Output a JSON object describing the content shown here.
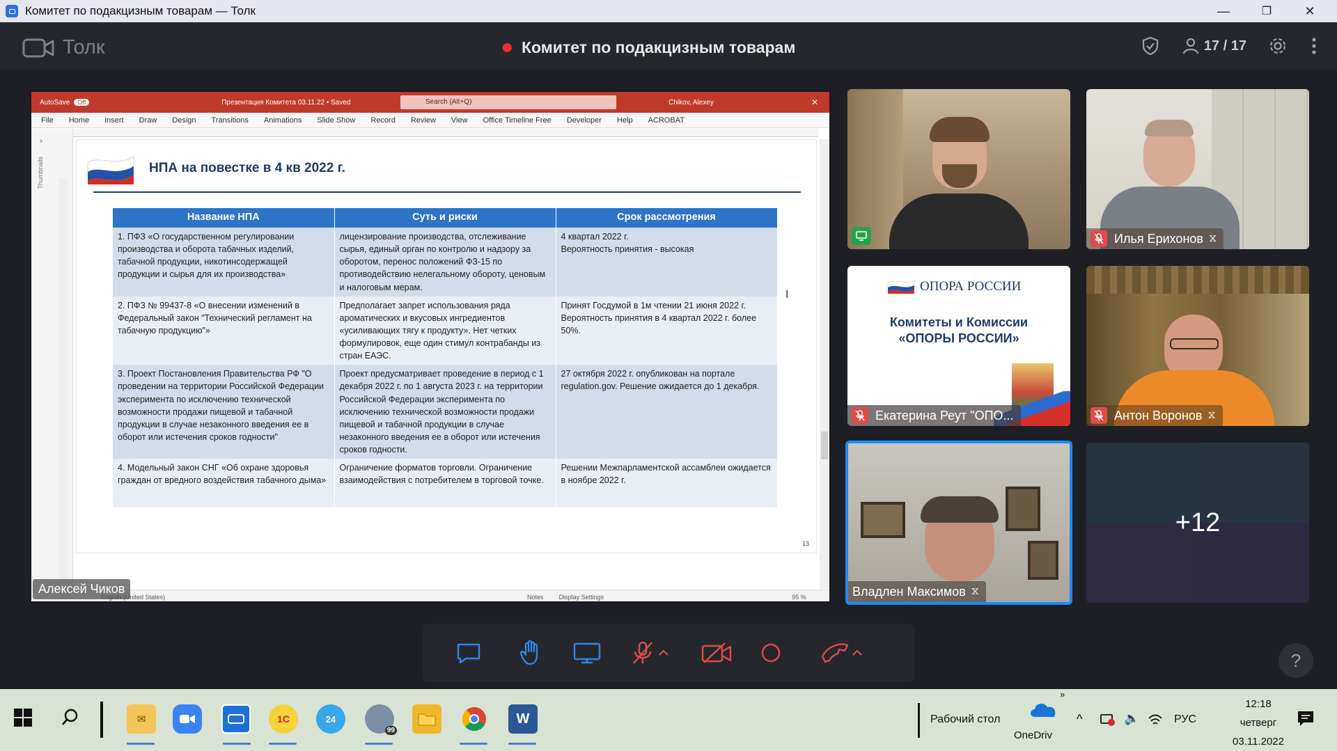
{
  "window": {
    "title": "Комитет по подакцизным товарам — Толк",
    "minimize": "—",
    "maximize": "❐",
    "close": "✕"
  },
  "header": {
    "brand": "Толк",
    "meeting_title": "Комитет по подакцизным товарам",
    "participants": "17 / 17"
  },
  "ppt": {
    "autosave": "AutoSave",
    "autosave_state": "Off",
    "doc_title": "Презентация Комитета 03.11.22 • Saved",
    "search_placeholder": "Search (Alt+Q)",
    "user": "Chikov, Alexey",
    "menu": [
      "File",
      "Home",
      "Insert",
      "Draw",
      "Design",
      "Transitions",
      "Animations",
      "Slide Show",
      "Record",
      "Review",
      "View",
      "Office Timeline Free",
      "Developer",
      "Help",
      "ACROBAT"
    ],
    "thumbnails_label": "Thumbnails",
    "status_left": "English (United States)",
    "status_notes": "Notes",
    "status_display": "Display Settings",
    "zoom": "95 %"
  },
  "slide": {
    "title": "НПА на повестке в 4 кв 2022 г.",
    "page_number": "13",
    "headers": [
      "Название НПА",
      "Суть и риски",
      "Срок рассмотрения"
    ],
    "rows": [
      {
        "name": "1. ПФЗ «О государственном регулировании производства и оборота табачных изделий, табачной продукции, никотинсодержащей продукции и сырья для их производства»",
        "essence": "лицензирование производства, отслеживание сырья, единый орган по контролю и надзору за оборотом, перенос положений ФЗ-15 по противодействию нелегальному обороту, ценовым и налоговым мерам.",
        "term": "4 квартал 2022 г.\nВероятность принятия - высокая"
      },
      {
        "name": "2. ПФЗ № 99437-8 «О внесении изменений в Федеральный закон \"Технический регламент на табачную продукцию\"»",
        "essence": "Предполагает запрет использования ряда ароматических и вкусовых ингредиентов «усиливающих тягу к продукту». Нет четких формулировок, еще один стимул контрабанды из стран ЕАЭС.",
        "term": "Принят Госдумой в 1м чтении 21 июня 2022 г.\nВероятность принятия в 4 квартал 2022 г. более 50%."
      },
      {
        "name": "3. Проект Постановления Правительства РФ \"О проведении на территории Российской Федерации эксперимента по исключению технической возможности продажи пищевой и табачной продукции в случае незаконного введения ее в оборот или истечения сроков годности\"",
        "essence": "Проект предусматривает проведение в период с 1 декабря 2022 г. по 1 августа 2023 г. на территории Российской Федерации эксперимента по исключению технической возможности продажи пищевой и табачной продукции в случае незаконного введения ее в оборот или истечения сроков годности.",
        "term": "27 октября 2022 г. опубликован на портале regulation.gov. Решение ожидается до 1 декабря."
      },
      {
        "name": "4. Модельный закон СНГ «Об охране здоровья граждан от вредного воздействия табачного дыма»",
        "essence": "Ограничение форматов торговли. Ограничение взаимодействия с потребителем в торговой точке.",
        "term": "Решении Межпарламентской ассамблеи ожидается в ноябре 2022 г."
      }
    ]
  },
  "presenter_name": "Алексей Чиков",
  "tiles": {
    "t1_name": "",
    "t2_name": "Илья Ерихонов",
    "t3_name": "Екатерина Реут \"ОПО...",
    "t3_logo_text": "ОПОРА РОССИИ",
    "t3_caption": "Комитеты и Комиссии «ОПОРЫ РОССИИ»",
    "t4_name": "Антон Воронов",
    "t5_name": "Владлен Максимов",
    "more": "+12"
  },
  "taskbar": {
    "desktop": "Рабочий стол",
    "onedrive": "OneDriv",
    "lang": "РУС",
    "time": "12:18",
    "weekday": "четверг",
    "date": "03.11.2022",
    "badge_99": "99"
  },
  "colors": {
    "accent": "#2e74c7",
    "ppt_red": "#c03a2b",
    "active_speaker": "#1a8cff",
    "mic_off": "#e04b4b"
  },
  "help": "?"
}
